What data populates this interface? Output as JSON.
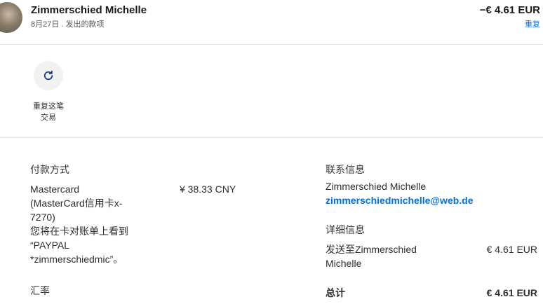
{
  "header": {
    "merchant_name": "Zimmerschied Michelle",
    "subtitle": "8月27日 . 发出的款项",
    "amount": "−€ 4.61 EUR",
    "repeat_link": "重复"
  },
  "actions": {
    "repeat_label_line1": "重复这笔",
    "repeat_label_line2": "交易",
    "repeat_icon": "refresh-icon"
  },
  "payment": {
    "title": "付款方式",
    "card_lines": [
      "Mastercard",
      "(MasterCard信用卡x-",
      "7270)",
      "您将在卡对账单上看到",
      "“PAYPAL",
      "*zimmerschiedmic”。"
    ],
    "amount": "¥ 38.33 CNY",
    "exchange_title": "汇率"
  },
  "contact": {
    "title": "联系信息",
    "name": "Zimmerschied Michelle",
    "email": "zimmerschiedmichelle@web.de"
  },
  "details": {
    "title": "详细信息",
    "sent_to_line1": "发送至Zimmerschied",
    "sent_to_line2": "Michelle",
    "sent_amount": "€ 4.61 EUR",
    "total_label": "总计",
    "total_amount": "€ 4.61 EUR"
  },
  "colors": {
    "link": "#0070e0",
    "divider": "#e6e6e6",
    "icon": "#1e3a8a"
  }
}
